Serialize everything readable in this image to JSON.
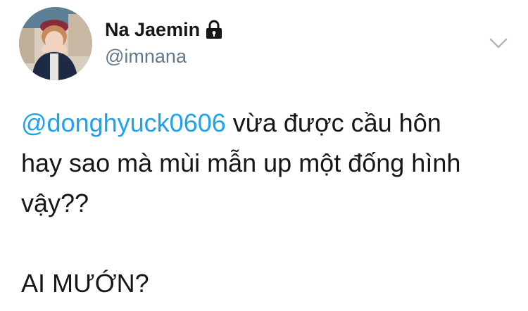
{
  "user": {
    "display_name": "Na Jaemin",
    "handle": "@imnana",
    "protected_icon": "lock-icon",
    "avatar_icon": "avatar-photo"
  },
  "menu": {
    "icon": "chevron-down-icon"
  },
  "tweet": {
    "mention": "@donghyuck0606",
    "line1_rest": " vừa được cầu hôn",
    "line2": "hay sao mà mùi mẫn up một đống hình",
    "line3": "vậy??",
    "line4": "AI MƯỚN?"
  },
  "colors": {
    "link": "#1da1f2",
    "text": "#14171a",
    "secondary": "#657786",
    "chevron": "#aab8c2"
  }
}
